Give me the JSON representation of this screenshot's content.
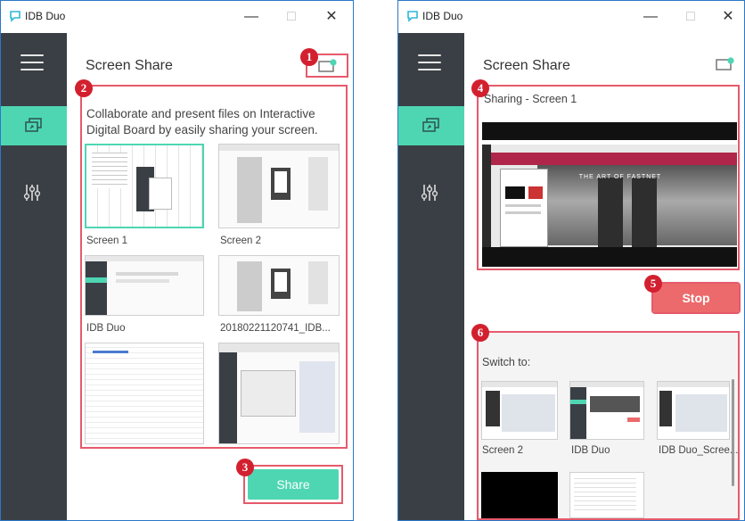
{
  "app_title": "IDB Duo",
  "window_controls": {
    "minimize": "—",
    "maximize": "□",
    "close": "✕"
  },
  "left": {
    "heading": "Screen Share",
    "description_line1": "Collaborate and present files on Interactive",
    "description_line2": "Digital Board by easily sharing your screen.",
    "screens": [
      {
        "label": "Screen 1",
        "selected": true
      },
      {
        "label": "Screen 2",
        "selected": false
      },
      {
        "label": "IDB Duo",
        "selected": false
      },
      {
        "label": "20180221120741_IDB...",
        "selected": false
      },
      {
        "label": "",
        "selected": false
      },
      {
        "label": "",
        "selected": false
      }
    ],
    "share_button": "Share"
  },
  "right": {
    "heading": "Screen Share",
    "sharing_label": "Sharing - Screen 1",
    "preview_banner_text": "THE ART OF FASTNET",
    "stop_button": "Stop",
    "switch_label": "Switch to:",
    "switch_items": [
      {
        "label": "Screen 2"
      },
      {
        "label": "IDB Duo"
      },
      {
        "label": "IDB Duo_Scree..."
      },
      {
        "label": ""
      },
      {
        "label": ""
      }
    ]
  },
  "badges": [
    "1",
    "2",
    "3",
    "4",
    "5",
    "6"
  ],
  "colors": {
    "accent": "#4ed6b3",
    "sidebar": "#3a3f45",
    "callout": "#d2202f",
    "stop": "#ec6a6b"
  },
  "icons": {
    "menu": "hamburger-icon",
    "screen_share": "screen-share-icon",
    "settings": "sliders-icon",
    "cast": "cast-icon"
  }
}
